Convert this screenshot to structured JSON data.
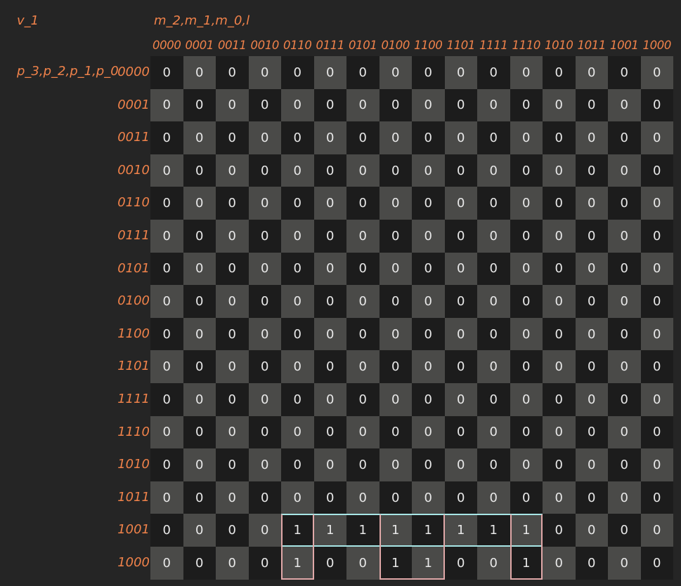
{
  "variable_name": "v_1",
  "column_variables": "m_2,m_1,m_0,l",
  "row_variables": "p_3,p_2,p_1,p_0",
  "column_headers": [
    "0000",
    "0001",
    "0011",
    "0010",
    "0110",
    "0111",
    "0101",
    "0100",
    "1100",
    "1101",
    "1111",
    "1110",
    "1010",
    "1011",
    "1001",
    "1000"
  ],
  "row_headers": [
    "0000",
    "0001",
    "0011",
    "0010",
    "0110",
    "0111",
    "0101",
    "0100",
    "1100",
    "1101",
    "1111",
    "1110",
    "1010",
    "1011",
    "1001",
    "1000"
  ],
  "cells": [
    [
      "0",
      "0",
      "0",
      "0",
      "0",
      "0",
      "0",
      "0",
      "0",
      "0",
      "0",
      "0",
      "0",
      "0",
      "0",
      "0"
    ],
    [
      "0",
      "0",
      "0",
      "0",
      "0",
      "0",
      "0",
      "0",
      "0",
      "0",
      "0",
      "0",
      "0",
      "0",
      "0",
      "0"
    ],
    [
      "0",
      "0",
      "0",
      "0",
      "0",
      "0",
      "0",
      "0",
      "0",
      "0",
      "0",
      "0",
      "0",
      "0",
      "0",
      "0"
    ],
    [
      "0",
      "0",
      "0",
      "0",
      "0",
      "0",
      "0",
      "0",
      "0",
      "0",
      "0",
      "0",
      "0",
      "0",
      "0",
      "0"
    ],
    [
      "0",
      "0",
      "0",
      "0",
      "0",
      "0",
      "0",
      "0",
      "0",
      "0",
      "0",
      "0",
      "0",
      "0",
      "0",
      "0"
    ],
    [
      "0",
      "0",
      "0",
      "0",
      "0",
      "0",
      "0",
      "0",
      "0",
      "0",
      "0",
      "0",
      "0",
      "0",
      "0",
      "0"
    ],
    [
      "0",
      "0",
      "0",
      "0",
      "0",
      "0",
      "0",
      "0",
      "0",
      "0",
      "0",
      "0",
      "0",
      "0",
      "0",
      "0"
    ],
    [
      "0",
      "0",
      "0",
      "0",
      "0",
      "0",
      "0",
      "0",
      "0",
      "0",
      "0",
      "0",
      "0",
      "0",
      "0",
      "0"
    ],
    [
      "0",
      "0",
      "0",
      "0",
      "0",
      "0",
      "0",
      "0",
      "0",
      "0",
      "0",
      "0",
      "0",
      "0",
      "0",
      "0"
    ],
    [
      "0",
      "0",
      "0",
      "0",
      "0",
      "0",
      "0",
      "0",
      "0",
      "0",
      "0",
      "0",
      "0",
      "0",
      "0",
      "0"
    ],
    [
      "0",
      "0",
      "0",
      "0",
      "0",
      "0",
      "0",
      "0",
      "0",
      "0",
      "0",
      "0",
      "0",
      "0",
      "0",
      "0"
    ],
    [
      "0",
      "0",
      "0",
      "0",
      "0",
      "0",
      "0",
      "0",
      "0",
      "0",
      "0",
      "0",
      "0",
      "0",
      "0",
      "0"
    ],
    [
      "0",
      "0",
      "0",
      "0",
      "0",
      "0",
      "0",
      "0",
      "0",
      "0",
      "0",
      "0",
      "0",
      "0",
      "0",
      "0"
    ],
    [
      "0",
      "0",
      "0",
      "0",
      "0",
      "0",
      "0",
      "0",
      "0",
      "0",
      "0",
      "0",
      "0",
      "0",
      "0",
      "0"
    ],
    [
      "0",
      "0",
      "0",
      "0",
      "1",
      "1",
      "1",
      "1",
      "1",
      "1",
      "1",
      "1",
      "0",
      "0",
      "0",
      "0"
    ],
    [
      "0",
      "0",
      "0",
      "0",
      "1",
      "0",
      "0",
      "1",
      "1",
      "0",
      "0",
      "1",
      "0",
      "0",
      "0",
      "0"
    ]
  ],
  "groupings": [
    {
      "color": "#a8e6e6",
      "rows": [
        14,
        14
      ],
      "cols": [
        4,
        11
      ]
    },
    {
      "color": "#e0a8a8",
      "rows": [
        14,
        15
      ],
      "cols": [
        4,
        4
      ]
    },
    {
      "color": "#e0a8a8",
      "rows": [
        14,
        15
      ],
      "cols": [
        7,
        8
      ]
    },
    {
      "color": "#e0a8a8",
      "rows": [
        14,
        15
      ],
      "cols": [
        11,
        11
      ]
    }
  ]
}
